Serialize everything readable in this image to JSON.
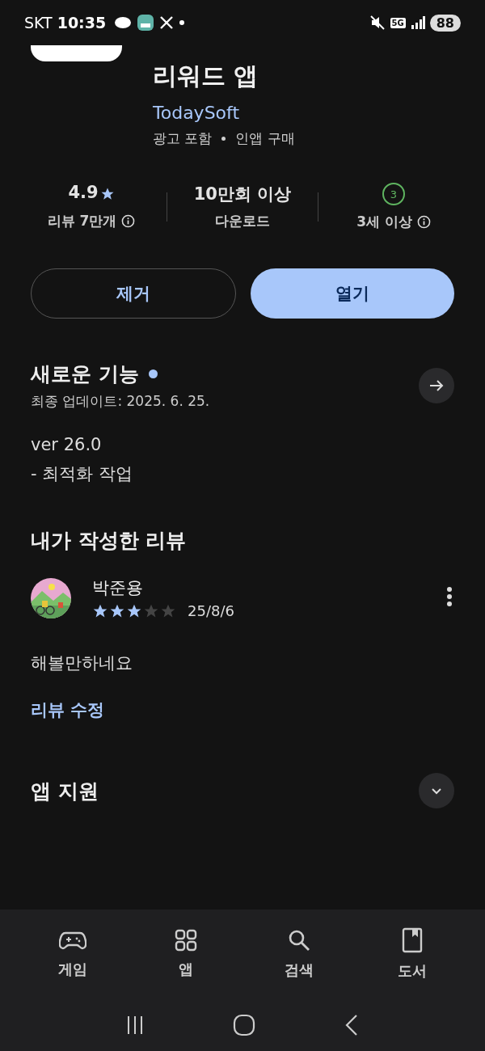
{
  "status_bar": {
    "carrier": "SKT",
    "time": "10:35",
    "network": "5G",
    "battery": "88"
  },
  "app": {
    "title": "리워드 앱",
    "developer": "TodaySoft",
    "notes": [
      "광고 포함",
      "인앱 구매"
    ]
  },
  "stats": [
    {
      "kind": "rating",
      "value": "4.9",
      "label": "리뷰 7만개",
      "info": true
    },
    {
      "kind": "text",
      "value": "10만회 이상",
      "label": "다운로드",
      "info": false
    },
    {
      "kind": "age",
      "value": "3",
      "label": "3세 이상",
      "info": true
    }
  ],
  "buttons": [
    {
      "label": "제거",
      "kind": "outline"
    },
    {
      "label": "열기",
      "kind": "filled"
    }
  ],
  "whats_new": {
    "title": "새로운 기능",
    "new": true,
    "updated": "최종 업데이트: 2025. 6. 25.",
    "lines": [
      "ver 26.0",
      "- 최적화 작업"
    ]
  },
  "my_review": {
    "title": "내가 작성한 리뷰",
    "author": "박준용",
    "stars": 3,
    "date": "25/8/6",
    "text": "해볼만하네요",
    "edit_link": "리뷰 수정"
  },
  "support": {
    "title": "앱 지원",
    "expanded": false
  },
  "bottom_nav": [
    {
      "label": "게임",
      "kind": "game"
    },
    {
      "label": "앱",
      "kind": "apps"
    },
    {
      "label": "검색",
      "kind": "search"
    },
    {
      "label": "도서",
      "kind": "book"
    }
  ]
}
